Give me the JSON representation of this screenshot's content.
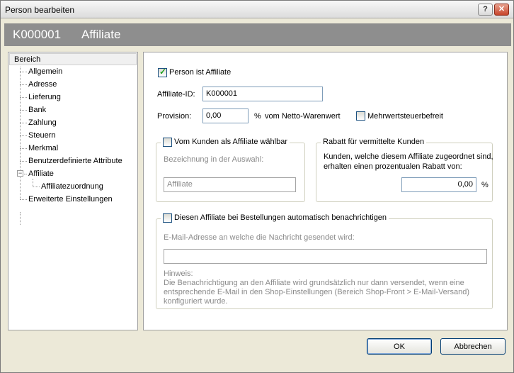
{
  "window": {
    "title": "Person bearbeiten"
  },
  "header": {
    "code": "K000001",
    "name": "Affiliate"
  },
  "sidebar": {
    "header": "Bereich",
    "items": [
      {
        "label": "Allgemein"
      },
      {
        "label": "Adresse"
      },
      {
        "label": "Lieferung"
      },
      {
        "label": "Bank"
      },
      {
        "label": "Zahlung"
      },
      {
        "label": "Steuern"
      },
      {
        "label": "Merkmal"
      },
      {
        "label": "Benutzerdefinierte Attribute"
      },
      {
        "label": "Affiliate",
        "selected": true,
        "expanded": true,
        "children": [
          {
            "label": "Affiliatezuordnung"
          }
        ]
      },
      {
        "label": "Erweiterte Einstellungen"
      }
    ]
  },
  "main": {
    "person_ist_affiliate": {
      "label": "Person ist Affiliate",
      "checked": true
    },
    "affiliate_id": {
      "label": "Affiliate-ID:",
      "value": "K000001"
    },
    "provision": {
      "label": "Provision:",
      "value": "0,00",
      "unit": "%",
      "suffix": "vom Netto-Warenwert"
    },
    "mwst": {
      "label": "Mehrwertsteuerbefreit",
      "checked": false
    },
    "auswahl_group": {
      "legend": "Vom Kunden als Affiliate wählbar",
      "checked": false,
      "bezeichnung_label": "Bezeichnung in der Auswahl:",
      "bezeichnung_value": "Affiliate"
    },
    "rabatt_group": {
      "legend": "Rabatt für vermittelte Kunden",
      "text_line1": "Kunden, welche diesem Affiliate zugeordnet sind,",
      "text_line2": "erhalten einen prozentualen Rabatt von:",
      "value": "0,00",
      "unit": "%"
    },
    "benachrichtigen_group": {
      "legend": "Diesen Affiliate bei Bestellungen automatisch benachrichtigen",
      "checked": false,
      "email_label": "E-Mail-Adresse an welche die Nachricht gesendet wird:",
      "email_value": "",
      "hint_title": "Hinweis:",
      "hint_line1": "Die Benachrichtigung an den Affiliate wird grundsätzlich nur dann versendet, wenn eine",
      "hint_line2": "entsprechende E-Mail in den Shop-Einstellungen (Bereich Shop-Front > E-Mail-Versand)",
      "hint_line3": "konfiguriert wurde."
    }
  },
  "buttons": {
    "ok": "OK",
    "cancel": "Abbrechen",
    "help": "?",
    "close": "✕"
  }
}
